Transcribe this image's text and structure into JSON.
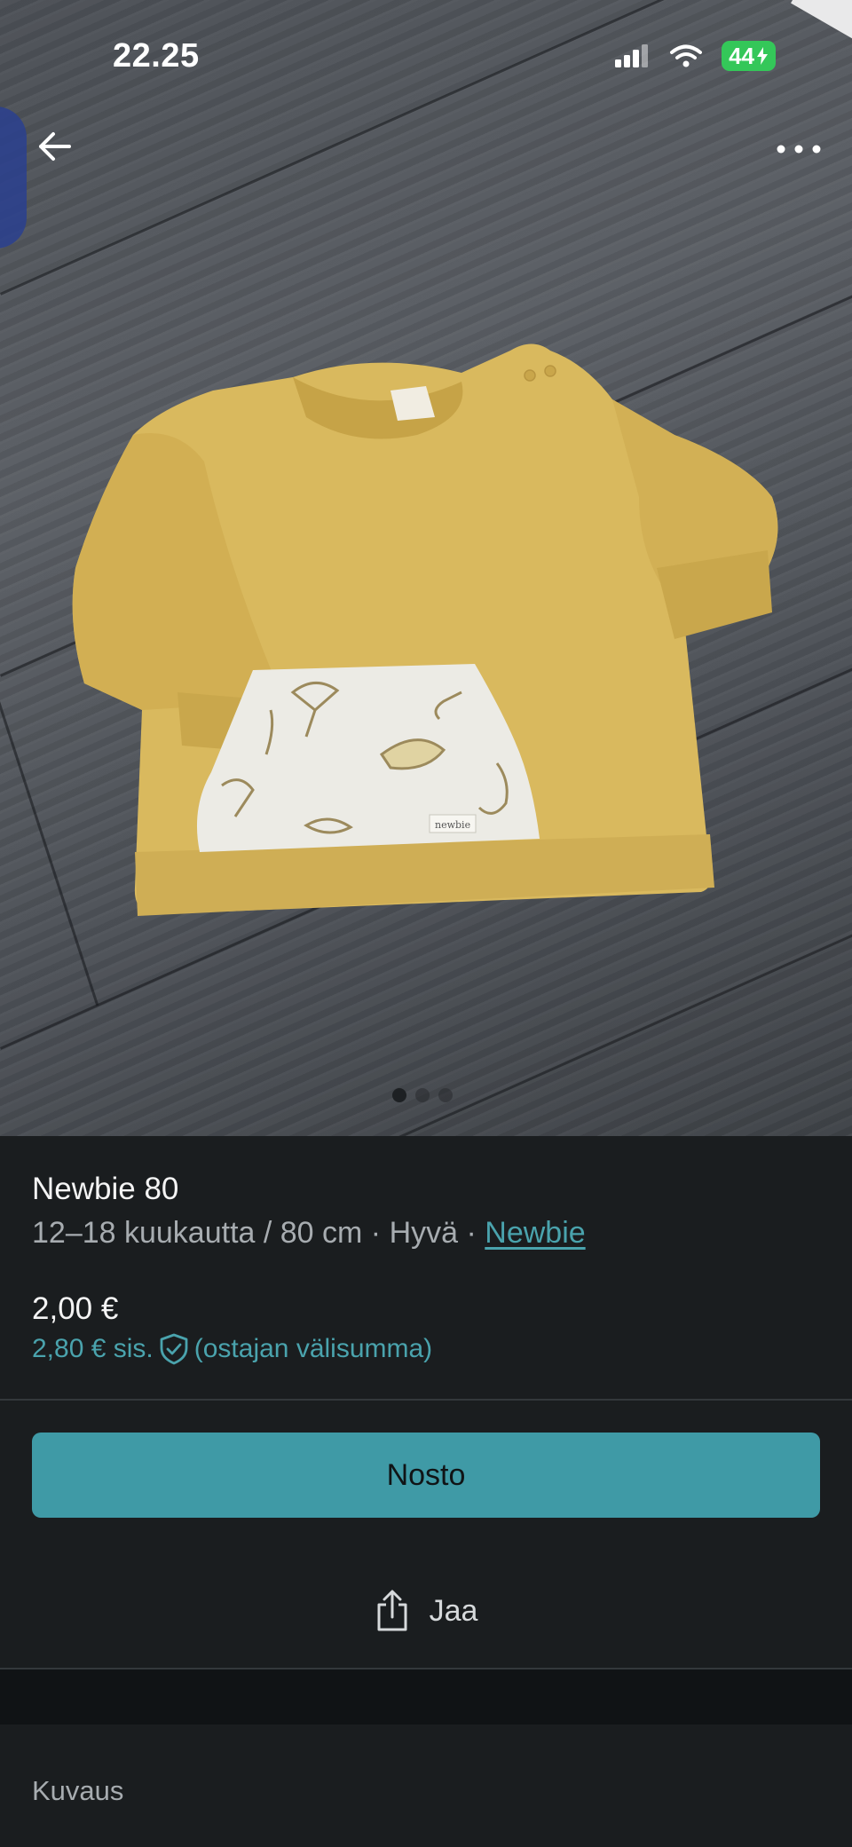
{
  "status_bar": {
    "time": "22.25",
    "battery": "44"
  },
  "photo": {
    "image_count": 3,
    "active_index": 0,
    "alt": "Keltainen vauvan collegepaita"
  },
  "item": {
    "title": "Newbie 80",
    "size": "12–18 kuukautta / 80 cm",
    "separator": " · ",
    "condition": "Hyvä",
    "brand": "Newbie"
  },
  "pricing": {
    "price": "2,00 €",
    "incl_price": "2,80 € sis.",
    "incl_note": "(ostajan välisumma)"
  },
  "actions": {
    "buy_label": "Nosto",
    "share_label": "Jaa"
  },
  "description": {
    "heading": "Kuvaus"
  },
  "colors": {
    "accent": "#3f9aa6",
    "link": "#4aa3ad",
    "background": "#1a1d1f"
  },
  "icons": {
    "back": "arrow-left-icon",
    "more": "more-horizontal-icon",
    "share": "share-icon",
    "protection": "shield-check-icon"
  }
}
